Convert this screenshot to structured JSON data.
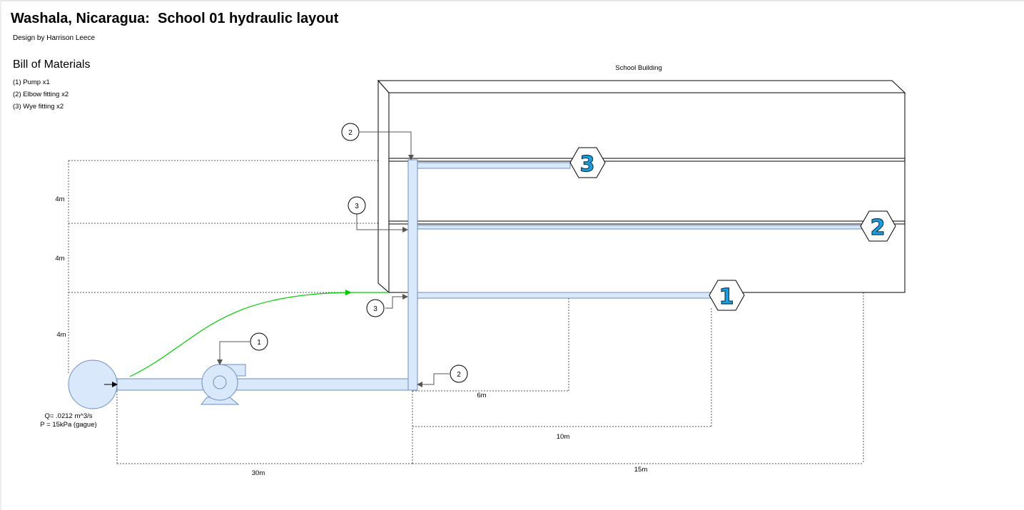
{
  "header": {
    "title": "Washala, Nicaragua:  School 01 hydraulic layout",
    "credit": "Design by Harrison Leece"
  },
  "bom": {
    "title": "Bill of Materials",
    "items": [
      "(1) Pump x1",
      "(2) Elbow fitting x2",
      "(3) Wye fitting x2"
    ]
  },
  "building": {
    "label": "School Building"
  },
  "source": {
    "flow": "Q= .0212 m^3/s",
    "pressure": "P = 15kPa (gague)"
  },
  "elevations": [
    "4m",
    "4m",
    "4m"
  ],
  "dimensions": {
    "main_run": "30m",
    "branch_3": "6m",
    "branch_1": "10m",
    "branch_2": "15m"
  },
  "callouts": {
    "elbow_top": "2",
    "wye_mid": "3",
    "wye_low": "3",
    "pump": "1",
    "elbow_bottom": "2"
  },
  "outlets": {
    "floor_1": "1",
    "floor_2": "2",
    "floor_3": "3"
  },
  "colors": {
    "pipe_fill": "#dae8fc",
    "pipe_stroke": "#6c8ebf",
    "outlet_number": "#1ba1e2",
    "flow_arrow": "#00cc00"
  }
}
